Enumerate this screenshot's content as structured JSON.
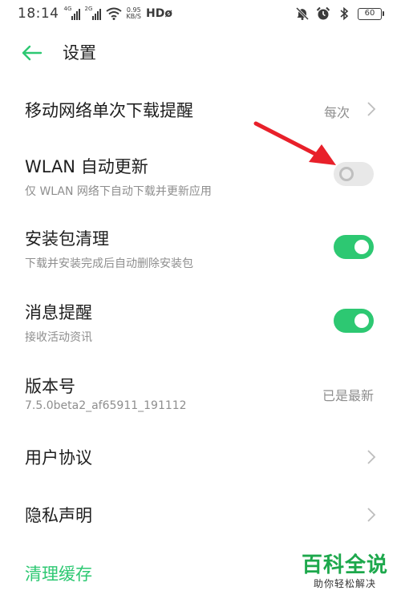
{
  "status_bar": {
    "time": "18:14",
    "sim1_label": "4G",
    "sim2_label": "2G",
    "speed_value": "0.95",
    "speed_unit": "KB/S",
    "hd_label": "HDø",
    "battery": "60",
    "icons": [
      "mute-icon",
      "alarm-icon",
      "bluetooth-icon"
    ]
  },
  "header": {
    "title": "设置",
    "back_icon": "arrow-left-icon"
  },
  "settings": {
    "mobile_download": {
      "title": "移动网络单次下载提醒",
      "value": "每次"
    },
    "wlan_update": {
      "title": "WLAN 自动更新",
      "subtitle": "仅 WLAN 网络下自动下载并更新应用",
      "enabled": false
    },
    "package_cleanup": {
      "title": "安装包清理",
      "subtitle": "下载并安装完成后自动删除安装包",
      "enabled": true
    },
    "notifications": {
      "title": "消息提醒",
      "subtitle": "接收活动资讯",
      "enabled": true
    },
    "version": {
      "title": "版本号",
      "subtitle": "7.5.0beta2_af65911_191112",
      "value": "已是最新"
    },
    "user_agreement": {
      "title": "用户协议"
    },
    "privacy": {
      "title": "隐私声明"
    },
    "clear_cache": {
      "label": "清理缓存"
    }
  },
  "colors": {
    "accent": "#2dc872",
    "toggle_off": "#e8e8e8",
    "annotation": "#e8202a",
    "watermark": "#1da84c"
  },
  "watermark": {
    "main": "百科全说",
    "sub": "助你轻松解决"
  }
}
